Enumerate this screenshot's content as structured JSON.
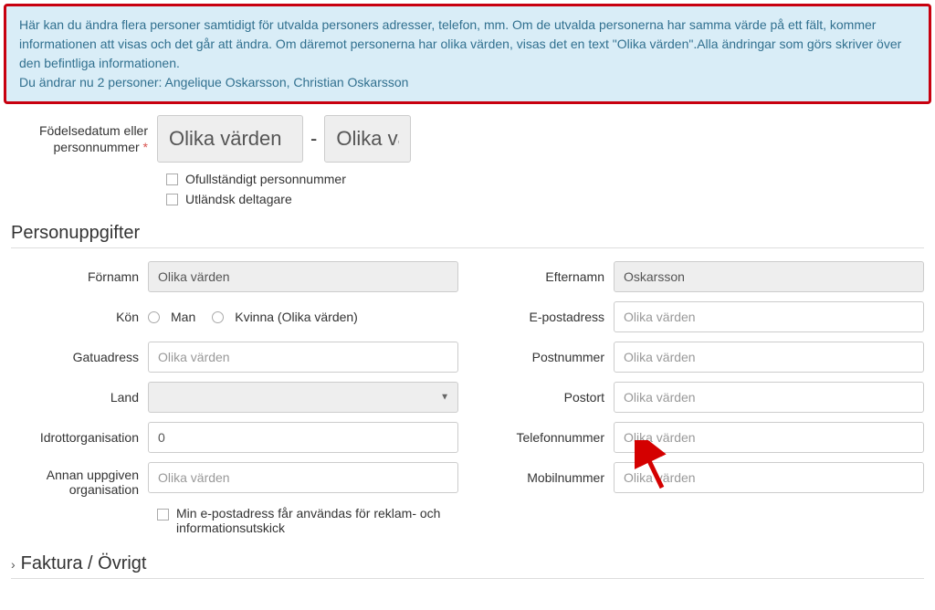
{
  "banner": {
    "line1": "Här kan du ändra flera personer samtidigt för utvalda personers adresser, telefon, mm. Om de utvalda personerna har samma värde på ett fält, kommer informationen att visas och det går att ändra. Om däremot personerna har olika värden, visas det en text \"Olika värden\".Alla ändringar som görs skriver över den befintliga informationen.",
    "line2": "Du ändrar nu 2 personer: Angelique Oskarsson, Christian Oskarsson"
  },
  "labels": {
    "birthOrSsn": "Födelsedatum eller personnummer",
    "incompleteSsn": "Ofullständigt personnummer",
    "foreignParticipant": "Utländsk deltagare",
    "sectionPerson": "Personuppgifter",
    "firstName": "Förnamn",
    "lastName": "Efternamn",
    "gender": "Kön",
    "genderMale": "Man",
    "genderFemale": "Kvinna (Olika värden)",
    "email": "E-postadress",
    "street": "Gatuadress",
    "zip": "Postnummer",
    "country": "Land",
    "city": "Postort",
    "sportOrg": "Idrottorganisation",
    "phone": "Telefonnummer",
    "otherOrg": "Annan uppgiven organisation",
    "mobile": "Mobilnummer",
    "emailOptIn": "Min e-postadress får användas för reklam- och informationsutskick",
    "invoiceSection": "Faktura / Övrigt"
  },
  "values": {
    "ssnPart1": "Olika värden",
    "ssnPart2": "Olika vä",
    "firstName": "Olika värden",
    "lastName": "Oskarsson",
    "sportOrg": "0"
  },
  "placeholders": {
    "mixed": "Olika värden"
  }
}
